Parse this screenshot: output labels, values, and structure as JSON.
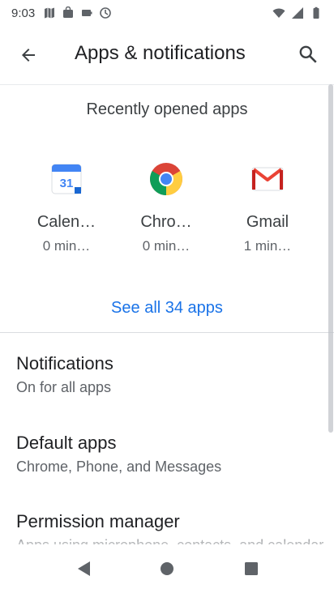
{
  "status_bar": {
    "time": "9:03",
    "left_icons": [
      "maps-icon",
      "shop-icon",
      "battery-icon",
      "signal-circle-icon"
    ],
    "right_icons": [
      "wifi-icon",
      "cell-signal-icon",
      "battery-icon"
    ]
  },
  "app_bar": {
    "title": "Apps & notifications",
    "back_icon": "back-arrow-icon",
    "search_icon": "search-icon"
  },
  "recent": {
    "heading": "Recently opened apps",
    "apps": [
      {
        "name": "Calen…",
        "time": "0 min…",
        "icon": "calendar-icon"
      },
      {
        "name": "Chro…",
        "time": "0 min…",
        "icon": "chrome-icon"
      },
      {
        "name": "Gmail",
        "time": "1 min…",
        "icon": "gmail-icon"
      }
    ],
    "calendar_day": "31",
    "see_all": "See all 34 apps"
  },
  "settings": [
    {
      "title": "Notifications",
      "summary": "On for all apps"
    },
    {
      "title": "Default apps",
      "summary": "Chrome, Phone, and Messages"
    },
    {
      "title": "Permission manager",
      "summary": "Apps using microphone, contacts, and calendar"
    }
  ],
  "colors": {
    "accent": "#1a73e8",
    "text_primary": "#202124",
    "text_secondary": "#5f6368"
  }
}
